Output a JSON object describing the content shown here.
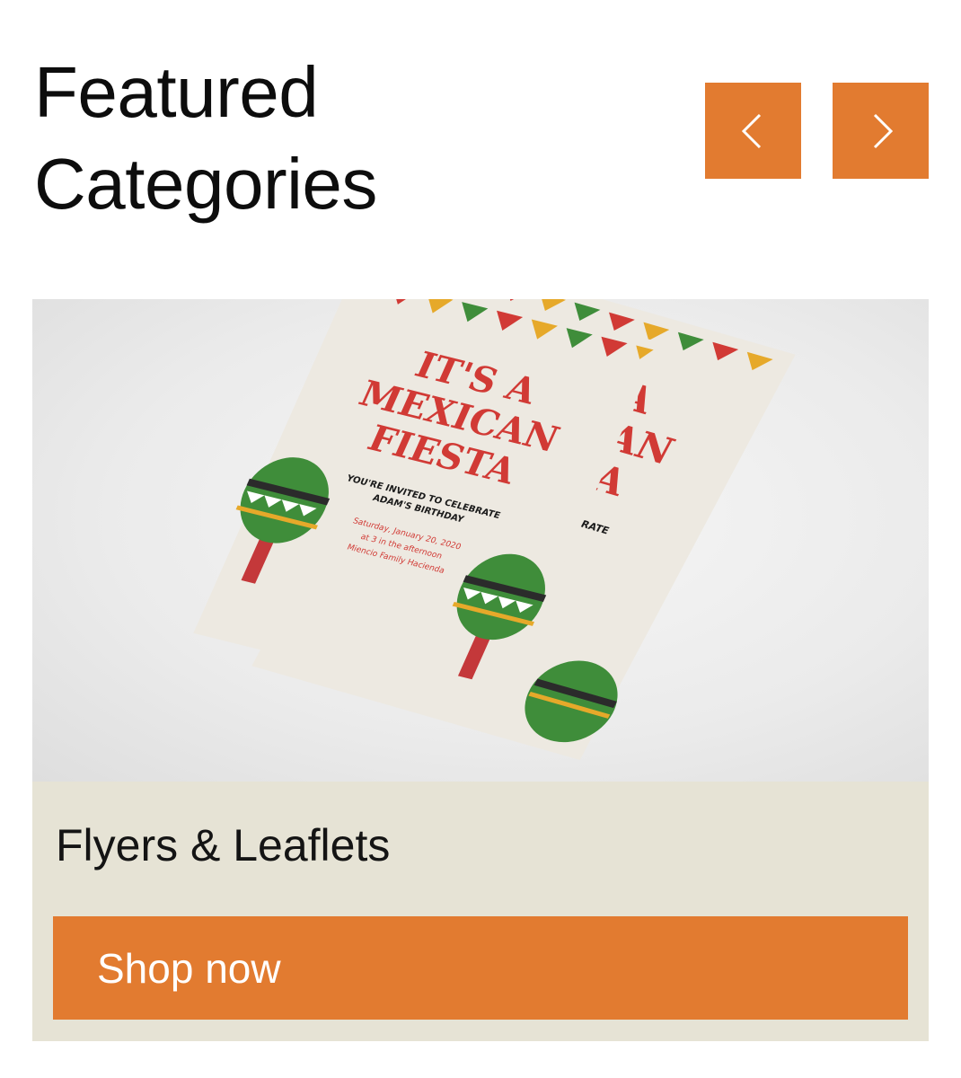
{
  "section": {
    "title_line1": "Featured",
    "title_line2": "Categories"
  },
  "carousel": {
    "prev_icon": "chevron-left-icon",
    "next_icon": "chevron-right-icon",
    "accent_color": "#e27b30"
  },
  "card": {
    "title": "Flyers & Leaflets",
    "button_label": "Shop now",
    "background_color": "#e6e3d5",
    "image": {
      "flyer_headline_1": "IT'S A",
      "flyer_headline_2": "MEXICAN",
      "flyer_headline_3": "FIESTA",
      "flyer_invite_1": "YOU'RE INVITED TO CELEBRATE",
      "flyer_invite_2": "ADAM'S BIRTHDAY",
      "flyer_date": "Saturday, January 20, 2020",
      "flyer_time": "at 3 in the afternoon",
      "flyer_place": "Miencio Family Hacienda"
    }
  }
}
